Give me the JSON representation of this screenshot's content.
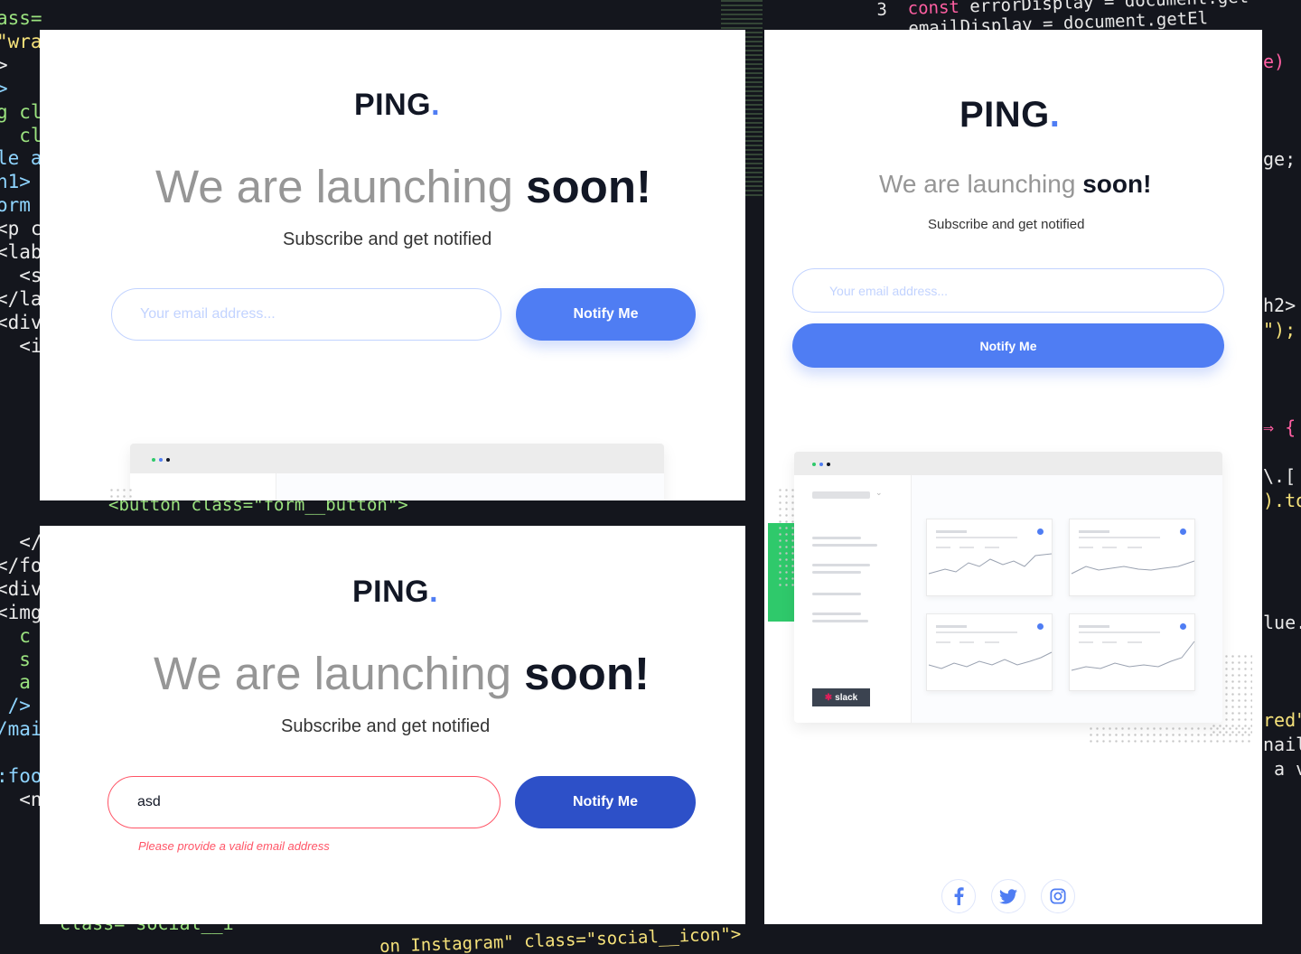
{
  "brand": {
    "name": "PING",
    "dot": "."
  },
  "headline": {
    "light": "We are launching ",
    "bold": "soon!"
  },
  "subtitle": "Subscribe and get notified",
  "email": {
    "placeholder": "Your email address...",
    "invalid_value": "asd",
    "error_message": "Please provide a valid email address"
  },
  "button": {
    "label": "Notify Me"
  },
  "dashboard": {
    "slack_label": "slack"
  },
  "social": [
    "facebook-icon",
    "twitter-icon",
    "instagram-icon"
  ],
  "colors": {
    "accent": "#4f7df3",
    "accent_active": "#2d50c8",
    "error": "#ff5466",
    "dark": "#121725",
    "gray": "#969696",
    "pale_blue": "#c2d3ff"
  },
  "code": {
    "left_lines": [
      "ass=\"wrapper\">",
      ">",
      "g cl",
      "  cla",
      "le ar",
      "h1>",
      "orm ",
      "<p c",
      "<lab",
      "  <s",
      "</la",
      "<div",
      "  <i"
    ],
    "left_lower": [
      "<button class=\"form__button\">"
    ],
    "left_bottom_lines": [
      "  </",
      "</fo",
      "<div",
      "<img",
      "  c",
      "  s",
      "  a",
      " />",
      "/mai",
      "",
      ":foot",
      "  <na",
      "    <"
    ],
    "right_top": [
      "3  const errorDisplay = document.get",
      "   emailDisplay = document.getEl"
    ],
    "right_side": [
      "e)",
      "",
      "",
      "",
      "ge;",
      "",
      "",
      "",
      "",
      "",
      "h2>",
      "\");",
      "",
      "",
      "",
      "⇒ {",
      "",
      "\\.[",
      ").to",
      "",
      "",
      "",
      "",
      "lue.",
      "",
      "",
      "",
      "red\"",
      "nail",
      " a v"
    ],
    "bottom_line": "\"social__icon\">",
    "bottom_line_2": "class=\"social__i",
    "bottom_line_3": "on Instagram\" class="
  }
}
